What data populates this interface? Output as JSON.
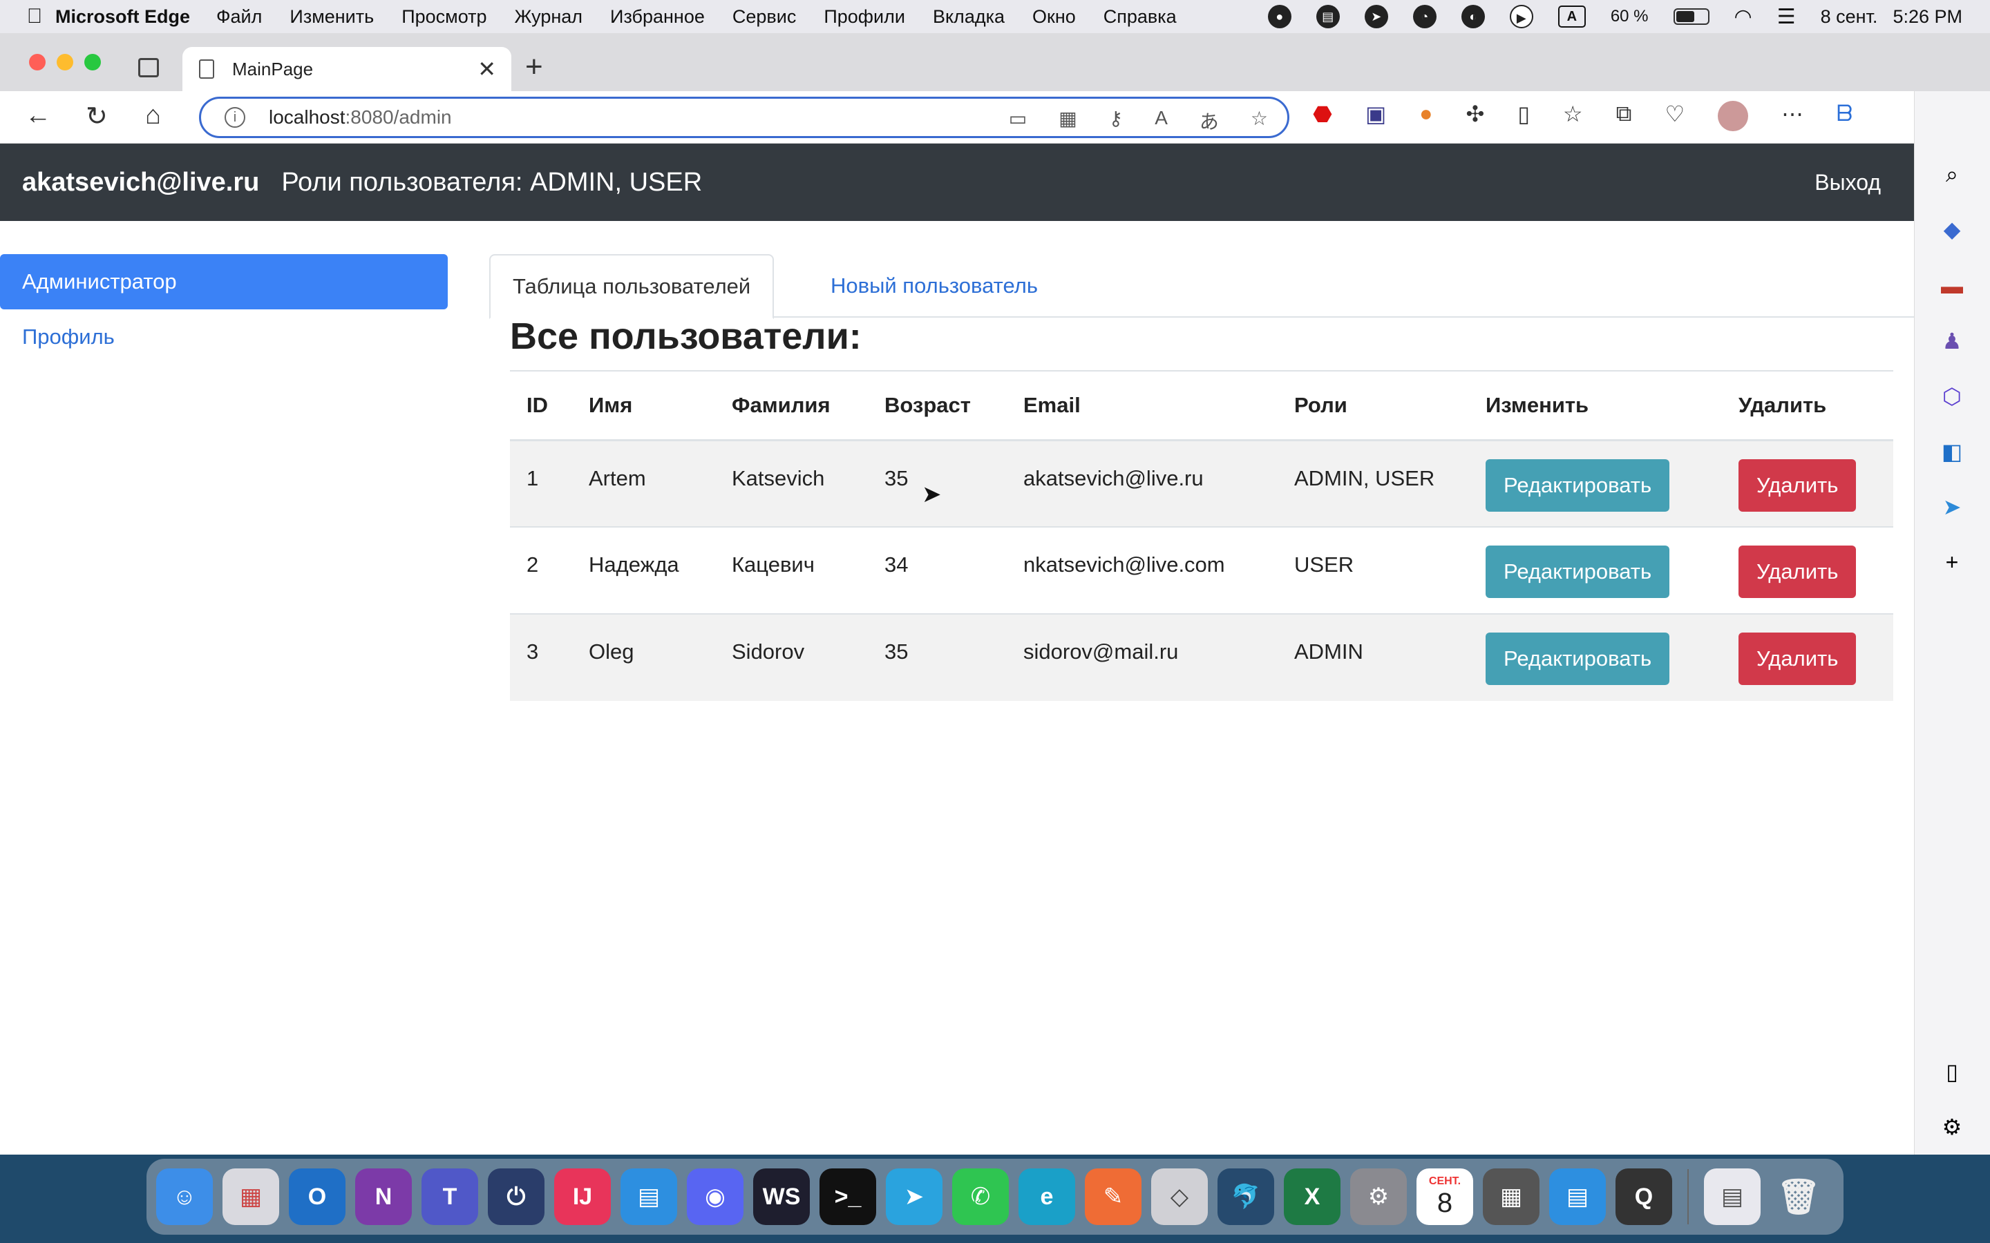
{
  "menubar": {
    "app_name": "Microsoft Edge",
    "items": [
      "Файл",
      "Изменить",
      "Просмотр",
      "Журнал",
      "Избранное",
      "Сервис",
      "Профили",
      "Вкладка",
      "Окно",
      "Справка"
    ],
    "battery": "60 %",
    "date": "8 сент.",
    "time": "5:26 PM",
    "input_source": "A"
  },
  "browser": {
    "tab_title": "MainPage",
    "url_host": "localhost",
    "url_path": ":8080/admin"
  },
  "navbar": {
    "email": "akatsevich@live.ru",
    "roles_text": "Роли пользователя: ADMIN, USER",
    "logout": "Выход"
  },
  "leftnav": {
    "admin": "Администратор",
    "profile": "Профиль"
  },
  "tabs": {
    "users_table": "Таблица пользователей",
    "new_user": "Новый пользователь"
  },
  "heading": "Все пользователи:",
  "table": {
    "headers": [
      "ID",
      "Имя",
      "Фамилия",
      "Возраст",
      "Email",
      "Роли",
      "Изменить",
      "Удалить"
    ],
    "rows": [
      {
        "id": "1",
        "name": "Artem",
        "surname": "Katsevich",
        "age": "35",
        "email": "akatsevich@live.ru",
        "roles": "ADMIN, USER"
      },
      {
        "id": "2",
        "name": "Надежда",
        "surname": "Кацевич",
        "age": "34",
        "email": "nkatsevich@live.com",
        "roles": "USER"
      },
      {
        "id": "3",
        "name": "Oleg",
        "surname": "Sidorov",
        "age": "35",
        "email": "sidorov@mail.ru",
        "roles": "ADMIN"
      }
    ],
    "edit_label": "Редактировать",
    "delete_label": "Удалить"
  },
  "dock": {
    "calendar_month": "СЕНТ.",
    "calendar_day": "8"
  },
  "colors": {
    "navbar_bg": "#343a40",
    "primary": "#3b82f6",
    "edit_button": "#45a0b4",
    "delete_button": "#d1394a"
  }
}
